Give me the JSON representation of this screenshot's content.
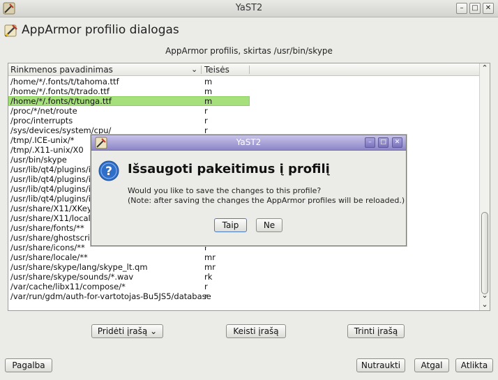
{
  "window": {
    "title": "YaST2",
    "minimize": "–",
    "maximize": "□",
    "close": "✕"
  },
  "page": {
    "title": "AppArmor profilio dialogas",
    "subtitle": "AppArmor profilis, skirtas /usr/bin/skype"
  },
  "table": {
    "columns": [
      "Rinkmenos pavadinimas",
      "Teisės"
    ],
    "rows": [
      {
        "path": "/home/*/.fonts/t/tahoma.ttf",
        "perm": "m"
      },
      {
        "path": "/home/*/.fonts/t/trado.ttf",
        "perm": "m"
      },
      {
        "path": "/home/*/.fonts/t/tunga.ttf",
        "perm": "m",
        "selected": true
      },
      {
        "path": "/proc/*/net/route",
        "perm": "r"
      },
      {
        "path": "/proc/interrupts",
        "perm": "r"
      },
      {
        "path": "/sys/devices/system/cpu/",
        "perm": "r"
      },
      {
        "path": "/tmp/.ICE-unix/*",
        "perm": ""
      },
      {
        "path": "/tmp/.X11-unix/X0",
        "perm": ""
      },
      {
        "path": "/usr/bin/skype",
        "perm": ""
      },
      {
        "path": "/usr/lib/qt4/plugins/ic",
        "perm": ""
      },
      {
        "path": "/usr/lib/qt4/plugins/im",
        "perm": ""
      },
      {
        "path": "/usr/lib/qt4/plugins/im",
        "perm": ""
      },
      {
        "path": "/usr/lib/qt4/plugins/in",
        "perm": ""
      },
      {
        "path": "/usr/share/X11/XKeys",
        "perm": ""
      },
      {
        "path": "/usr/share/X11/locale",
        "perm": ""
      },
      {
        "path": "/usr/share/fonts/**",
        "perm": ""
      },
      {
        "path": "/usr/share/ghostscrip",
        "perm": ""
      },
      {
        "path": "/usr/share/icons/**",
        "perm": "r"
      },
      {
        "path": "/usr/share/locale/**",
        "perm": "mr"
      },
      {
        "path": "/usr/share/skype/lang/skype_lt.qm",
        "perm": "mr"
      },
      {
        "path": "/usr/share/skype/sounds/*.wav",
        "perm": "rk"
      },
      {
        "path": "/var/cache/libx11/compose/*",
        "perm": "r"
      },
      {
        "path": "/var/run/gdm/auth-for-vartotojas-Bu5JS5/database",
        "perm": "r"
      }
    ]
  },
  "actions": {
    "add": "Pridėti įrašą",
    "edit": "Keisti įrašą",
    "delete": "Trinti įrašą"
  },
  "footer": {
    "help": "Pagalba",
    "cancel": "Nutraukti",
    "back": "Atgal",
    "finish": "Atlikta"
  },
  "dialog": {
    "title": "YaST2",
    "heading": "Išsaugoti pakeitimus į profilį",
    "line1": "Would you like to save the changes to this profile?",
    "line2": "(Note: after saving the changes the AppArmor profiles will be reloaded.)",
    "yes": "Taip",
    "no": "Ne"
  }
}
